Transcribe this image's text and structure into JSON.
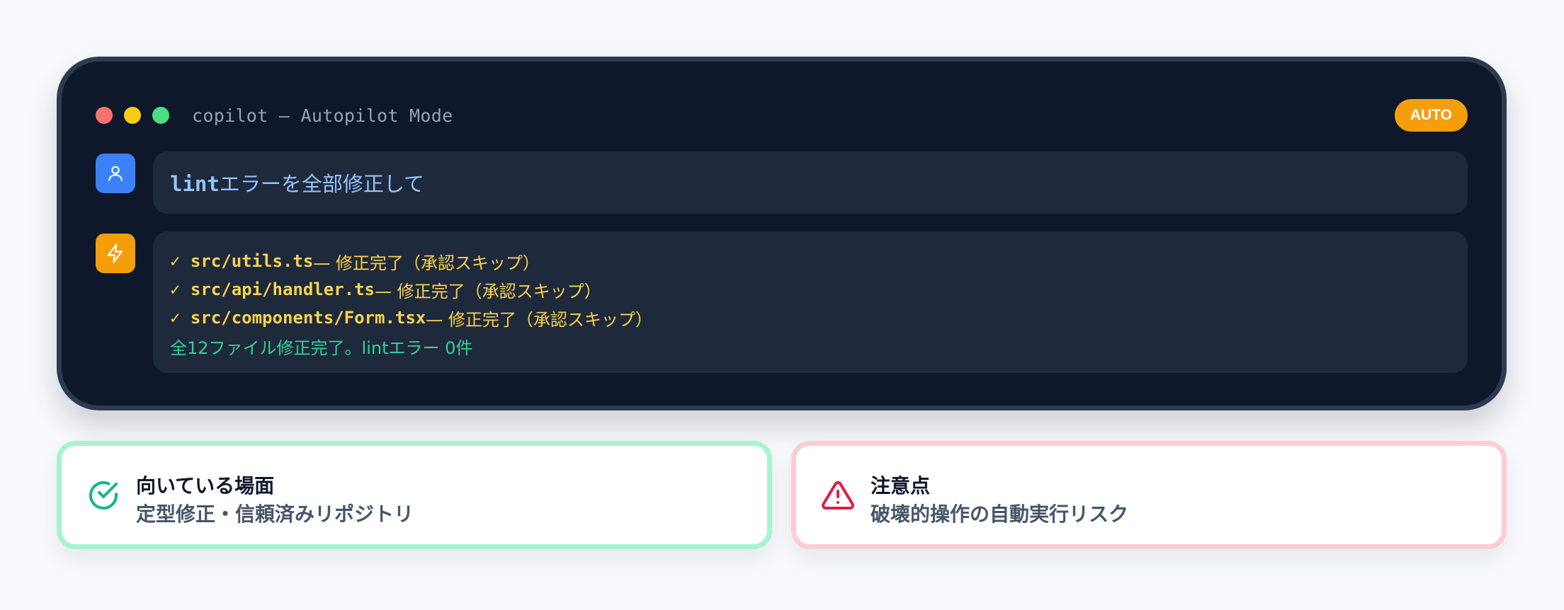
{
  "window": {
    "title": "copilot — Autopilot Mode",
    "badge": "AUTO",
    "controls": [
      "close",
      "minimize",
      "maximize"
    ]
  },
  "conversation": {
    "user": {
      "avatar_icon": "user-icon",
      "command": "lint",
      "message": "エラーを全部修正して"
    },
    "assistant": {
      "avatar_icon": "lightning-icon",
      "results": [
        {
          "check": "✓",
          "file": "src/utils.ts",
          "status": " — 修正完了（承認スキップ）"
        },
        {
          "check": "✓",
          "file": "src/api/handler.ts",
          "status": " — 修正完了（承認スキップ）"
        },
        {
          "check": "✓",
          "file": "src/components/Form.tsx",
          "status": " — 修正完了（承認スキップ）"
        }
      ],
      "summary": "全12ファイル修正完了。lintエラー 0件"
    }
  },
  "cards": {
    "good": {
      "icon": "check-circle-icon",
      "title": "向いている場面",
      "description": "定型修正・信頼済みリポジトリ"
    },
    "warn": {
      "icon": "warning-triangle-icon",
      "title": "注意点",
      "description": "破壊的操作の自動実行リスク"
    }
  },
  "colors": {
    "terminal_bg": "#0f172a",
    "bubble_bg": "#1e293b",
    "accent_amber": "#f59e0b",
    "user_blue": "#3b82f6",
    "success_green": "#34d399",
    "warning_red": "#e11d48"
  }
}
